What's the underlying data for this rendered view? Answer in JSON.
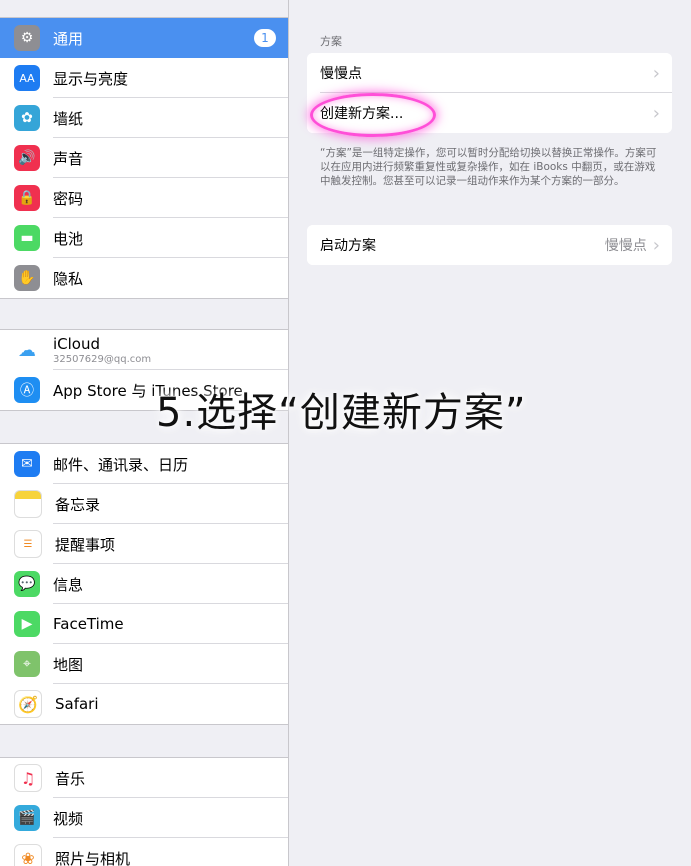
{
  "sidebar": {
    "group1": [
      {
        "label": "通用",
        "icon": "gear-icon",
        "color": "#8e8e93",
        "badge": "1",
        "selected": true
      },
      {
        "label": "显示与亮度",
        "icon": "display-brightness-icon",
        "color": "#1e7cf2"
      },
      {
        "label": "墙纸",
        "icon": "wallpaper-icon",
        "color": "#35a5d8"
      },
      {
        "label": "声音",
        "icon": "speaker-icon",
        "color": "#f0304f"
      },
      {
        "label": "密码",
        "icon": "lock-icon",
        "color": "#f0304f"
      },
      {
        "label": "电池",
        "icon": "battery-icon",
        "color": "#4cd964"
      },
      {
        "label": "隐私",
        "icon": "hand-icon",
        "color": "#8e8e93"
      }
    ],
    "icloud": {
      "label": "iCloud",
      "sub": "32507629@qq.com"
    },
    "appstore": {
      "label": "App Store 与 iTunes Store"
    },
    "group3": [
      {
        "label": "邮件、通讯录、日历",
        "icon": "mail-icon",
        "color": "#1e7cf2"
      },
      {
        "label": "备忘录",
        "icon": "notes-icon",
        "color": "#f7d33b"
      },
      {
        "label": "提醒事项",
        "icon": "reminders-icon",
        "color": "#ffffff"
      },
      {
        "label": "信息",
        "icon": "messages-icon",
        "color": "#4cd964"
      },
      {
        "label": "FaceTime",
        "icon": "facetime-icon",
        "color": "#4cd964"
      },
      {
        "label": "地图",
        "icon": "maps-icon",
        "color": "#7fc36b"
      },
      {
        "label": "Safari",
        "icon": "safari-icon",
        "color": "#1e7cf2"
      }
    ],
    "group4": [
      {
        "label": "音乐",
        "icon": "music-icon",
        "color": "#ffffff"
      },
      {
        "label": "视频",
        "icon": "video-icon",
        "color": "#34aadc"
      },
      {
        "label": "照片与相机",
        "icon": "photos-icon",
        "color": "#ffffff"
      }
    ]
  },
  "detail": {
    "section_header": "方案",
    "recipes": [
      {
        "label": "慢慢点"
      },
      {
        "label": "创建新方案..."
      }
    ],
    "footer_note": "“方案”是一组特定操作，您可以暂时分配给切换以替换正常操作。方案可以在应用内进行频繁重复性或复杂操作，如在 iBooks 中翻页，或在游戏中触发控制。您甚至可以记录一组动作来作为某个方案的一部分。",
    "launch": {
      "label": "启动方案",
      "value": "慢慢点"
    }
  },
  "overlay_caption": "5.选择“创建新方案”",
  "accent_color": "#4a90f0",
  "highlight_color": "#ff4fd8"
}
